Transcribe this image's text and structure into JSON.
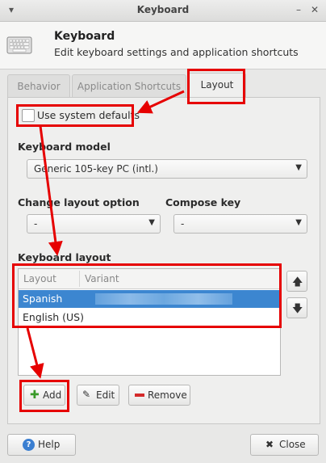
{
  "window": {
    "title": "Keyboard"
  },
  "header": {
    "title": "Keyboard",
    "subtitle": "Edit keyboard settings and application shortcuts"
  },
  "tabs": [
    {
      "label": "Behavior"
    },
    {
      "label": "Application Shortcuts"
    },
    {
      "label": "Layout"
    }
  ],
  "layout": {
    "use_system_defaults_label": "Use system defaults",
    "use_system_defaults_checked": false,
    "keyboard_model_label": "Keyboard model",
    "keyboard_model_value": "Generic 105-key PC (intl.)",
    "change_layout_option_label": "Change layout option",
    "change_layout_option_value": "-",
    "compose_key_label": "Compose key",
    "compose_key_value": "-",
    "keyboard_layout_label": "Keyboard layout",
    "columns": [
      "Layout",
      "Variant"
    ],
    "rows": [
      {
        "layout": "Spanish",
        "variant": "",
        "selected": true
      },
      {
        "layout": "English (US)",
        "variant": "",
        "selected": false
      }
    ],
    "add_label": "Add",
    "edit_label": "Edit",
    "remove_label": "Remove"
  },
  "footer": {
    "help_label": "Help",
    "close_label": "Close"
  },
  "colors": {
    "highlight": "#e60000",
    "selection": "#3c86d0"
  }
}
